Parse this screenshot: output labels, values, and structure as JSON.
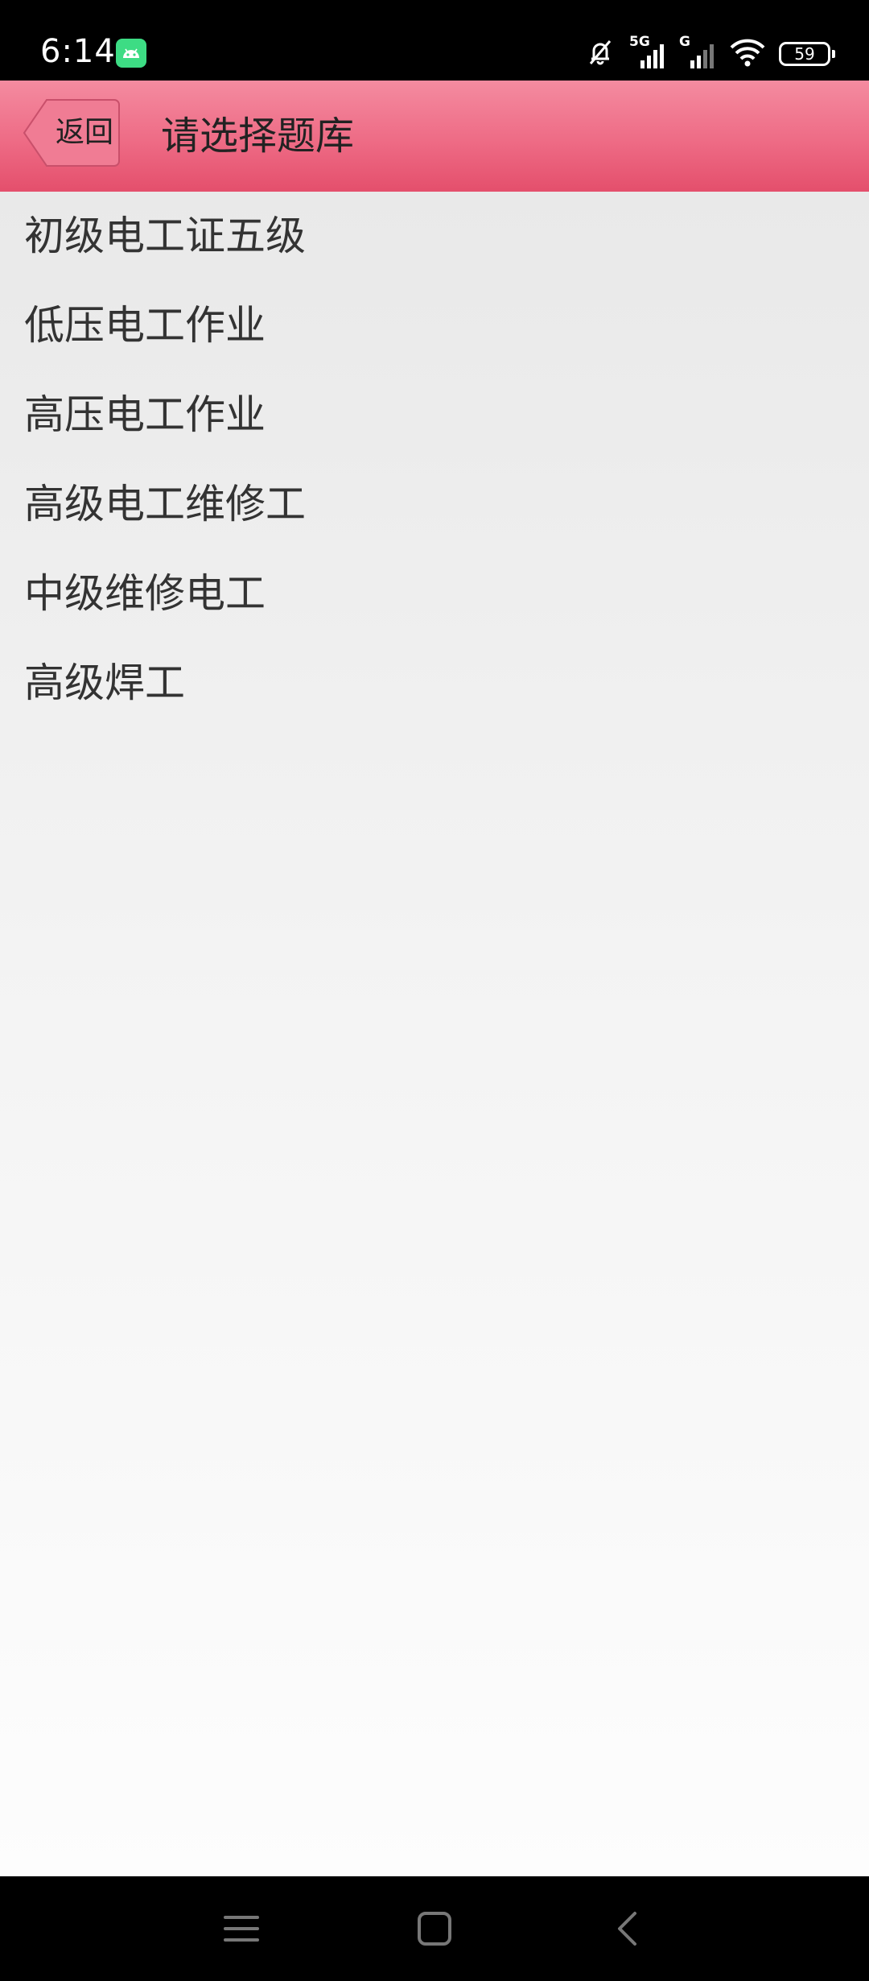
{
  "status_bar": {
    "time": "6:14",
    "network_primary": "5G",
    "network_secondary": "G",
    "battery_level": "59",
    "icons": [
      "android-notification-icon",
      "mute-bell-icon",
      "cellular-signal-icon",
      "wifi-icon",
      "battery-icon"
    ]
  },
  "header": {
    "back_label": "返回",
    "title": "请选择题库"
  },
  "question_banks": [
    "初级电工证五级",
    "低压电工作业",
    "高压电工作业",
    "高级电工维修工",
    "中级维修电工",
    "高级焊工"
  ],
  "nav_bar": {
    "icons": [
      "recent-apps-icon",
      "home-icon",
      "back-icon"
    ]
  },
  "colors": {
    "header_top": "#f48ba0",
    "header_bottom": "#e44f6c",
    "back_button_fill": "#f07c94",
    "list_text": "#333333",
    "android_badge": "#3ddc84"
  }
}
